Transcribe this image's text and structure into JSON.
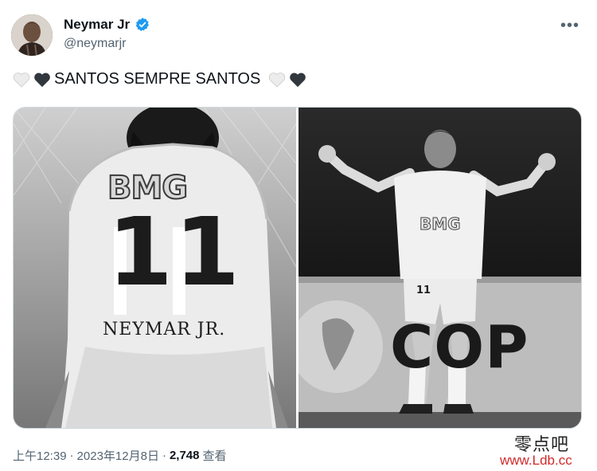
{
  "author": {
    "display_name": "Neymar Jr",
    "handle": "@neymarjr",
    "verified_icon": "verified-badge-icon",
    "verified_color": "#1d9bf0"
  },
  "more_icon": "more-horizontal-icon",
  "more_label": "•••",
  "tweet": {
    "text": "SANTOS SEMPRE SANTOS",
    "leading_emoji": [
      "white-heart",
      "black-heart"
    ],
    "trailing_emoji": [
      "white-heart",
      "black-heart"
    ]
  },
  "media": {
    "left_photo": {
      "jersey_sponsor": "BMG",
      "jersey_number": "11",
      "jersey_name": "NEYMAR JR."
    },
    "right_photo": {
      "jersey_sponsor": "BMG",
      "ad_board_text": "COP",
      "player_number": "11"
    }
  },
  "meta": {
    "time": "上午12:39",
    "separator": "·",
    "date": "2023年12月8日",
    "views_count": "2,748",
    "views_label": "查看"
  },
  "watermark": {
    "chinese": "零点吧",
    "url": "www.Ldb.cc"
  }
}
